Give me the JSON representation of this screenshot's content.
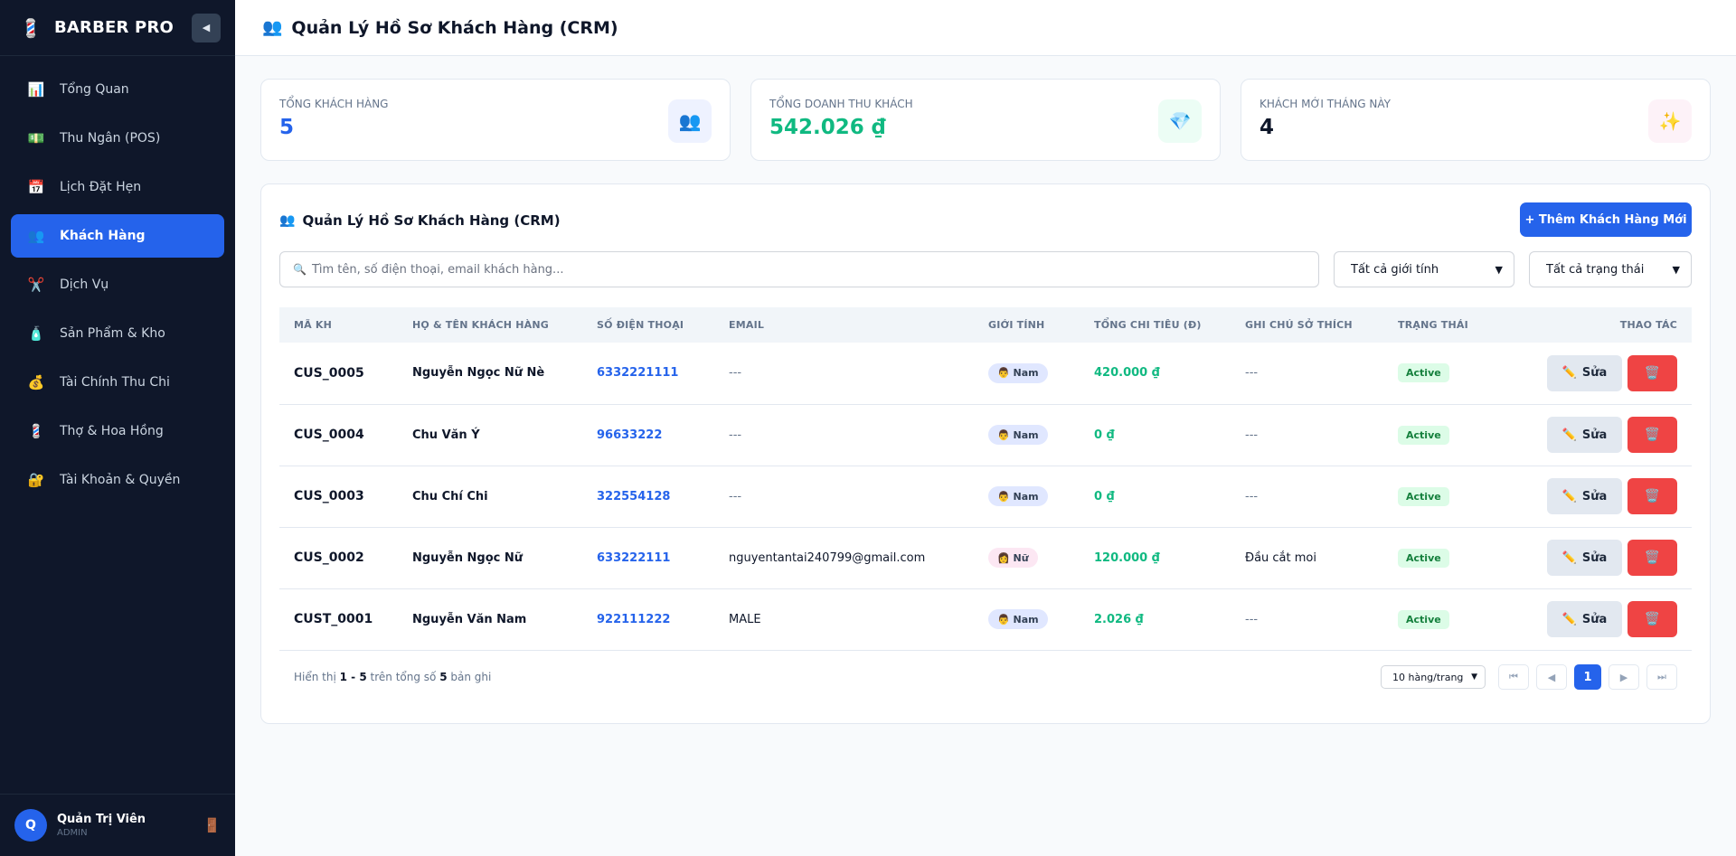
{
  "brand": {
    "name": "BARBER PRO",
    "logo_icon": "💈",
    "collapse_icon": "◀"
  },
  "sidebar": {
    "items": [
      {
        "label": "Tổng Quan",
        "icon": "📊"
      },
      {
        "label": "Thu Ngân (POS)",
        "icon": "💵"
      },
      {
        "label": "Lịch Đặt Hẹn",
        "icon": "📅"
      },
      {
        "label": "Khách Hàng",
        "icon": "👥",
        "active": true
      },
      {
        "label": "Dịch Vụ",
        "icon": "✂️"
      },
      {
        "label": "Sản Phẩm & Kho",
        "icon": "🧴"
      },
      {
        "label": "Tài Chính Thu Chi",
        "icon": "💰"
      },
      {
        "label": "Thợ & Hoa Hồng",
        "icon": "💈"
      },
      {
        "label": "Tài Khoản & Quyền",
        "icon": "🔐"
      }
    ]
  },
  "user": {
    "initial": "Q",
    "name": "Quản Trị Viên",
    "role": "ADMIN",
    "logout_icon": "🚪"
  },
  "header": {
    "icon": "👥",
    "title": "Quản Lý Hồ Sơ Khách Hàng (CRM)"
  },
  "stats": [
    {
      "label": "Tổng khách hàng",
      "value": "5",
      "icon": "👥",
      "color": "#2563eb",
      "icon_bg": "#eef2ff"
    },
    {
      "label": "Tổng doanh thu khách",
      "value": "542.026 ₫",
      "icon": "💎",
      "color": "#10b981",
      "icon_bg": "#ecfdf5"
    },
    {
      "label": "Khách mới tháng này",
      "value": "4",
      "icon": "✨",
      "color": "#0f172a",
      "icon_bg": "#fdf2f8"
    }
  ],
  "panel": {
    "icon": "👥",
    "title": "Quản Lý Hồ Sơ Khách Hàng (CRM)",
    "add_button": "+ Thêm Khách Hàng Mới",
    "search_icon": "🔍",
    "search_placeholder": "Tìm tên, số điện thoại, email khách hàng...",
    "gender_filter": "Tất cả giới tính",
    "status_filter": "Tất cả trạng thái"
  },
  "table": {
    "columns": [
      "Mã KH",
      "Họ & Tên Khách Hàng",
      "Số Điện Thoại",
      "Email",
      "Giới Tính",
      "Tổng Chi Tiêu (Đ)",
      "Ghi Chú Sở Thích",
      "Trạng Thái",
      "Thao Tác"
    ],
    "edit_label": "Sửa",
    "edit_icon": "✏️",
    "delete_icon": "🗑️",
    "rows": [
      {
        "id": "CUS_0005",
        "name": "Nguyễn Ngọc Nữ Nè",
        "phone": "6332221111",
        "email": "---",
        "gender": "Nam",
        "gender_icon": "👨",
        "spent": "420.000 ₫",
        "note": "---",
        "status": "Active"
      },
      {
        "id": "CUS_0004",
        "name": "Chu Văn Ý",
        "phone": "96633222",
        "email": "---",
        "gender": "Nam",
        "gender_icon": "👨",
        "spent": "0 ₫",
        "note": "---",
        "status": "Active"
      },
      {
        "id": "CUS_0003",
        "name": "Chu Chí Chi",
        "phone": "322554128",
        "email": "---",
        "gender": "Nam",
        "gender_icon": "👨",
        "spent": "0 ₫",
        "note": "---",
        "status": "Active"
      },
      {
        "id": "CUS_0002",
        "name": "Nguyễn Ngọc Nữ",
        "phone": "633222111",
        "email": "nguyentantai240799@gmail.com",
        "gender": "Nữ",
        "gender_icon": "👩",
        "spent": "120.000 ₫",
        "note": "Đầu cắt moi",
        "status": "Active"
      },
      {
        "id": "CUST_0001",
        "name": "Nguyễn Văn Nam",
        "phone": "922111222",
        "email": "MALE",
        "gender": "Nam",
        "gender_icon": "👨",
        "spent": "2.026 ₫",
        "note": "---",
        "status": "Active"
      }
    ]
  },
  "footer": {
    "prefix": "Hiển thị",
    "range": "1 - 5",
    "middle": "trên tổng số",
    "total": "5",
    "suffix": "bản ghi",
    "per_page": "10 hàng/trang",
    "first": "⏮",
    "prev": "◀",
    "page": "1",
    "next": "▶",
    "last": "⏭"
  }
}
